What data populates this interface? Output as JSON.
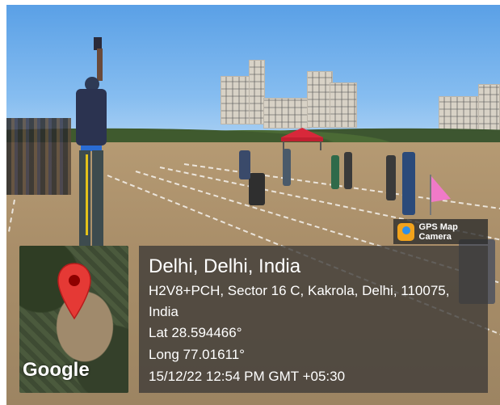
{
  "photo": {
    "description_icon": "sports-field-photo"
  },
  "map": {
    "brand": "Google",
    "pin_icon": "map-pin-icon",
    "pin_color": "#e53935"
  },
  "location": {
    "title": "Delhi, Delhi, India",
    "address_line1": "H2V8+PCH, Sector 16 C, Kakrola, Delhi, 110075,",
    "address_line2": "India",
    "lat": "Lat 28.594466°",
    "long": "Long 77.01611°",
    "datetime": "15/12/22 12:54 PM GMT +05:30"
  },
  "badge": {
    "label": "GPS Map Camera",
    "icon": "gps-map-camera-icon"
  }
}
